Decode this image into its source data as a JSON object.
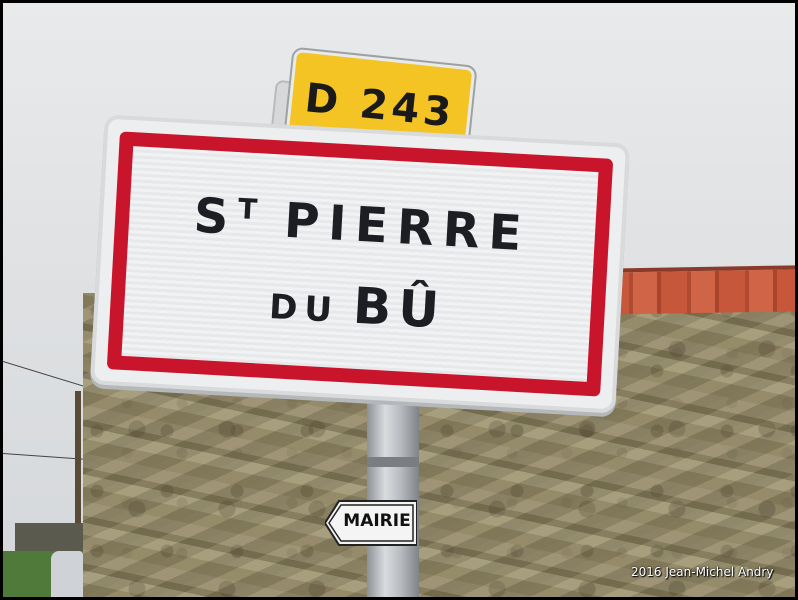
{
  "road_plate": {
    "text": "D 243",
    "color": "#f3c424"
  },
  "town_sign": {
    "line1_prefix": "S",
    "line1_sup": "T",
    "line1_main": "PIERRE",
    "line2_small": "DU",
    "line2_big": "BÛ",
    "border_color": "#c8152c"
  },
  "direction_sign": {
    "text": "MAIRIE",
    "arrow_icon": "left-arrow-icon"
  },
  "credit": {
    "text": "2016 Jean-Michel Andry"
  }
}
